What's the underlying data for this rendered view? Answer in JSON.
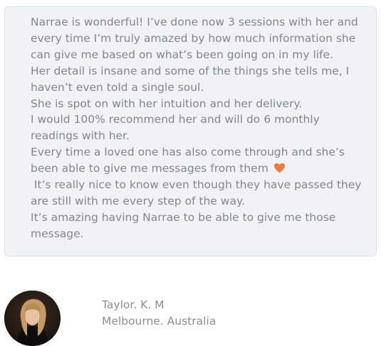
{
  "testimonial": {
    "lines": [
      "Narrae is wonderful!  I’ve done now 3 sessions with her and",
      "every time I’m truly amazed by how much information she",
      "can give me based on what’s been going on in my life.",
      "Her detail is insane and some of the things she tells me, I",
      "haven’t even told a single soul.",
      "She is spot on with her intuition and her delivery.",
      "I would 100% recommend her and will do 6 monthly",
      "readings with her.",
      "Every time a loved one has also come through and she’s",
      "been able to give me messages from them",
      " It’s really nice to know even though they have passed they",
      "are still with me every step of the way.",
      "It’s amazing having Narrae to be able to give me those",
      "message."
    ],
    "heart_icon": "orange-heart-icon",
    "heart_color": "#f07a3a"
  },
  "reviewer": {
    "name": "Taylor. K. M",
    "location": "Melbourne. Australia",
    "avatar_icon": "reviewer-photo"
  },
  "colors": {
    "card_background": "#f1f2f5",
    "card_border": "#dfe1e6",
    "text": "#80878f",
    "reviewer_text": "#8a8f96"
  }
}
